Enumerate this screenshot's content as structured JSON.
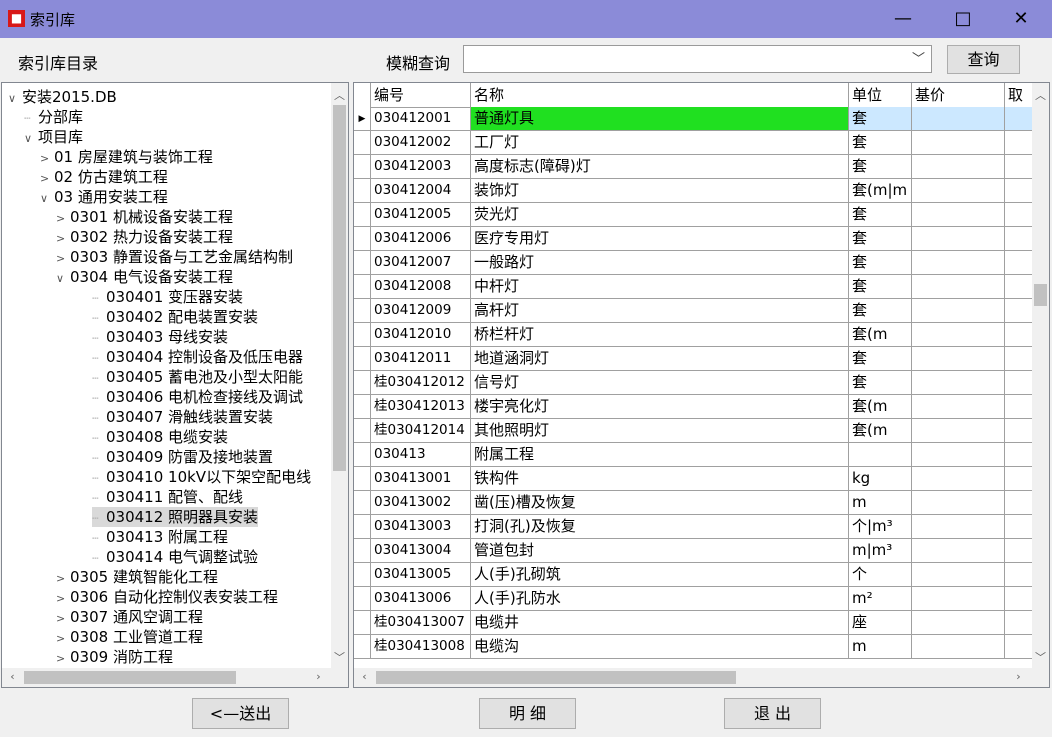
{
  "window": {
    "title": "索引库",
    "icon_glyph": "■",
    "min": "—",
    "max": "□",
    "close": "✕"
  },
  "toolbar": {
    "catalog_label": "索引库目录",
    "search_label": "模糊查询",
    "search_value": "",
    "query_btn": "查询"
  },
  "tree": [
    {
      "t": "安装2015.DB",
      "l": 0,
      "e": "v"
    },
    {
      "t": "分部库",
      "l": 1,
      "e": ""
    },
    {
      "t": "项目库",
      "l": 1,
      "e": "v"
    },
    {
      "t": "01 房屋建筑与装饰工程",
      "l": 2,
      "e": ">"
    },
    {
      "t": "02 仿古建筑工程",
      "l": 2,
      "e": ">"
    },
    {
      "t": "03 通用安装工程",
      "l": 2,
      "e": "v"
    },
    {
      "t": "0301 机械设备安装工程",
      "l": 3,
      "e": ">"
    },
    {
      "t": "0302 热力设备安装工程",
      "l": 3,
      "e": ">"
    },
    {
      "t": "0303 静置设备与工艺金属结构制",
      "l": 3,
      "e": ">"
    },
    {
      "t": "0304 电气设备安装工程",
      "l": 3,
      "e": "v"
    },
    {
      "t": "030401 变压器安装",
      "l": 4,
      "e": ""
    },
    {
      "t": "030402 配电装置安装",
      "l": 4,
      "e": ""
    },
    {
      "t": "030403 母线安装",
      "l": 4,
      "e": ""
    },
    {
      "t": "030404 控制设备及低压电器",
      "l": 4,
      "e": ""
    },
    {
      "t": "030405 蓄电池及小型太阳能",
      "l": 4,
      "e": ""
    },
    {
      "t": "030406 电机检查接线及调试",
      "l": 4,
      "e": ""
    },
    {
      "t": "030407 滑触线装置安装",
      "l": 4,
      "e": ""
    },
    {
      "t": "030408 电缆安装",
      "l": 4,
      "e": ""
    },
    {
      "t": "030409 防雷及接地装置",
      "l": 4,
      "e": ""
    },
    {
      "t": "030410 10kV以下架空配电线",
      "l": 4,
      "e": ""
    },
    {
      "t": "030411 配管、配线",
      "l": 4,
      "e": ""
    },
    {
      "t": "030412 照明器具安装",
      "l": 4,
      "e": "",
      "sel": true
    },
    {
      "t": "030413 附属工程",
      "l": 4,
      "e": ""
    },
    {
      "t": "030414 电气调整试验",
      "l": 4,
      "e": ""
    },
    {
      "t": "0305 建筑智能化工程",
      "l": 3,
      "e": ">"
    },
    {
      "t": "0306 自动化控制仪表安装工程",
      "l": 3,
      "e": ">"
    },
    {
      "t": "0307 通风空调工程",
      "l": 3,
      "e": ">"
    },
    {
      "t": "0308 工业管道工程",
      "l": 3,
      "e": ">"
    },
    {
      "t": "0309 消防工程",
      "l": 3,
      "e": ">"
    }
  ],
  "grid": {
    "columns": [
      "编号",
      "名称",
      "单位",
      "基价",
      "取"
    ],
    "rows": [
      [
        "030412001",
        "普通灯具",
        "套",
        ""
      ],
      [
        "030412002",
        "工厂灯",
        "套",
        ""
      ],
      [
        "030412003",
        "高度标志(障碍)灯",
        "套",
        ""
      ],
      [
        "030412004",
        "装饰灯",
        "套(m|m",
        ""
      ],
      [
        "030412005",
        "荧光灯",
        "套",
        ""
      ],
      [
        "030412006",
        "医疗专用灯",
        "套",
        ""
      ],
      [
        "030412007",
        "一般路灯",
        "套",
        ""
      ],
      [
        "030412008",
        "中杆灯",
        "套",
        ""
      ],
      [
        "030412009",
        "高杆灯",
        "套",
        ""
      ],
      [
        "030412010",
        "桥栏杆灯",
        "套(m",
        ""
      ],
      [
        "030412011",
        "地道涵洞灯",
        "套",
        ""
      ],
      [
        "桂030412012",
        "信号灯",
        "套",
        ""
      ],
      [
        "桂030412013",
        "楼宇亮化灯",
        "套(m",
        ""
      ],
      [
        "桂030412014",
        "其他照明灯",
        "套(m",
        ""
      ],
      [
        "030413",
        "附属工程",
        "",
        ""
      ],
      [
        "030413001",
        "铁构件",
        "kg",
        ""
      ],
      [
        "030413002",
        "凿(压)槽及恢复",
        "m",
        ""
      ],
      [
        "030413003",
        "打洞(孔)及恢复",
        "个|m³",
        ""
      ],
      [
        "030413004",
        "管道包封",
        "m|m³",
        ""
      ],
      [
        "030413005",
        "人(手)孔砌筑",
        "个",
        ""
      ],
      [
        "030413006",
        "人(手)孔防水",
        "m²",
        ""
      ],
      [
        "桂030413007",
        "电缆井",
        "座",
        ""
      ],
      [
        "桂030413008",
        "电缆沟",
        "m",
        ""
      ]
    ],
    "selected_row": 0,
    "highlight_color": "#20e020"
  },
  "buttons": {
    "send": "<—送出",
    "detail": "明 细",
    "exit": "退 出"
  }
}
